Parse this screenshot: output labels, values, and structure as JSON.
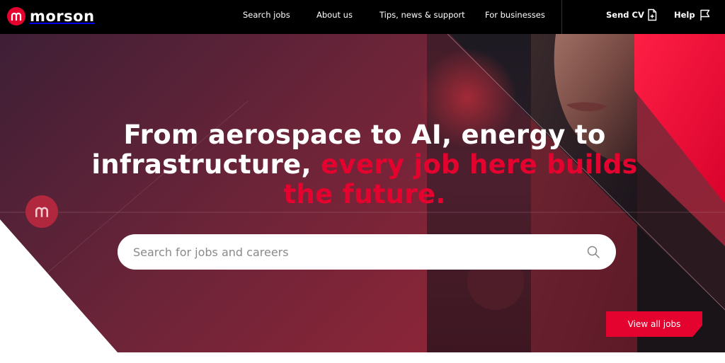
{
  "brand": {
    "name": "morson",
    "accent_color": "#e4032e"
  },
  "nav": {
    "links": [
      {
        "label": "Search jobs"
      },
      {
        "label": "About us"
      },
      {
        "label": "Tips, news & support"
      },
      {
        "label": "For businesses"
      }
    ],
    "send_cv_label": "Send CV",
    "help_label": "Help",
    "icons": [
      "document-plus-icon",
      "flag-icon"
    ]
  },
  "hero": {
    "headline_white": "From aerospace to AI, energy to infrastructure,",
    "headline_accent": "every job here builds the future.",
    "search_placeholder": "Search for jobs and careers",
    "search_value": "",
    "cta_label": "View all jobs",
    "colors": {
      "background_start": "#3e1f36",
      "background_end": "#952235",
      "accent": "#e4032e"
    }
  }
}
